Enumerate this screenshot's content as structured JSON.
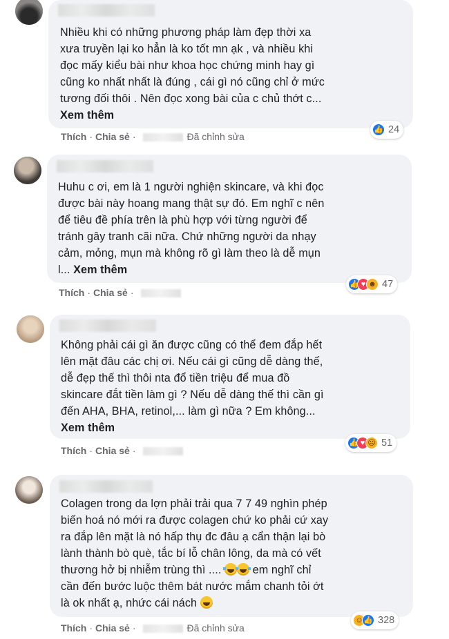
{
  "comments": [
    {
      "lines": [
        "Nhiều khi có những phương pháp làm đẹp thời xa",
        "xưa truyền lại ko hẳn là ko tốt mn ạk , và nhiều khi",
        "đọc mấy kiểu bài như khoa học chứng minh hay gì",
        "cũng ko nhất nhất là đúng , cái gì nó cũng chỉ ở mức",
        "tương đối thôi . Nên đọc xong bài của c chủ thớt c..."
      ],
      "more": "Xem thêm",
      "like": "Thích",
      "share": "Chia sẻ",
      "edited": "Đã chỉnh sửa",
      "reaction_icons": [
        "like-icon"
      ],
      "reaction_count": "24"
    },
    {
      "lines": [
        "Huhu c ơi, em là 1 người nghiện skincare, và khi đọc",
        "được bài này hoang mang thật sự đó. Em nghĩ c nên",
        "để tiêu đề phía trên là phù hợp với từng người để",
        "tránh gây tranh cãi nữa. Chứ những người da nhạy",
        "cảm, mỏng, mụn mà không rõ gì làm theo là dễ mụn"
      ],
      "last_prefix": "l... ",
      "more": "Xem thêm",
      "like": "Thích",
      "share": "Chia sẻ",
      "reaction_icons": [
        "like-icon",
        "love-icon",
        "care-icon"
      ],
      "reaction_count": "47"
    },
    {
      "lines": [
        "Không phải cái gì ăn được cũng có thể đem đắp hết",
        "lên mặt đâu các chị ơi. Nếu cái gì cũng dễ dàng thế,",
        "dễ đẹp thế thì thôi nta đổ tiền triệu để mua đồ",
        "skincare đắt tiền làm gì ? Nếu dễ dàng thế thì cần gì",
        "đến AHA, BHA, retinol,... làm gì nữa ? Em không..."
      ],
      "more": "Xem thêm",
      "like": "Thích",
      "share": "Chia sẻ",
      "reaction_icons": [
        "like-icon",
        "love-icon",
        "sad-icon"
      ],
      "reaction_count": "51"
    },
    {
      "lines": [
        "Colagen trong da lợn phải trải qua 7 7 49 nghìn phép",
        "biến hoá nó mới ra được colagen chứ ko phải cứ xay",
        "ra đắp lên mặt là nó hấp thụ đc đâu ạ cẩn thận lại bò",
        "lành thành bò què, tắc bí lỗ chân lông, da mà có vết",
        "thương hở bị nhiễm trùng thì ....",
        "cần đến bước luộc thêm bát nước mắm chanh tỏi ớt",
        "là ok nhất ạ, nhức cái nách"
      ],
      "line5_suffix": " em nghĩ chỉ",
      "like": "Thích",
      "share": "Chia sẻ",
      "edited": "Đã chỉnh sửa",
      "reaction_icons": [
        "haha-icon",
        "like-icon"
      ],
      "reaction_count": "328"
    }
  ],
  "colors": {
    "bubble": "#f0f2f5",
    "text": "#1c1e21",
    "meta": "#65676b",
    "like": "#1877f2",
    "love": "#f33e58",
    "emoji": "#f7b125"
  }
}
